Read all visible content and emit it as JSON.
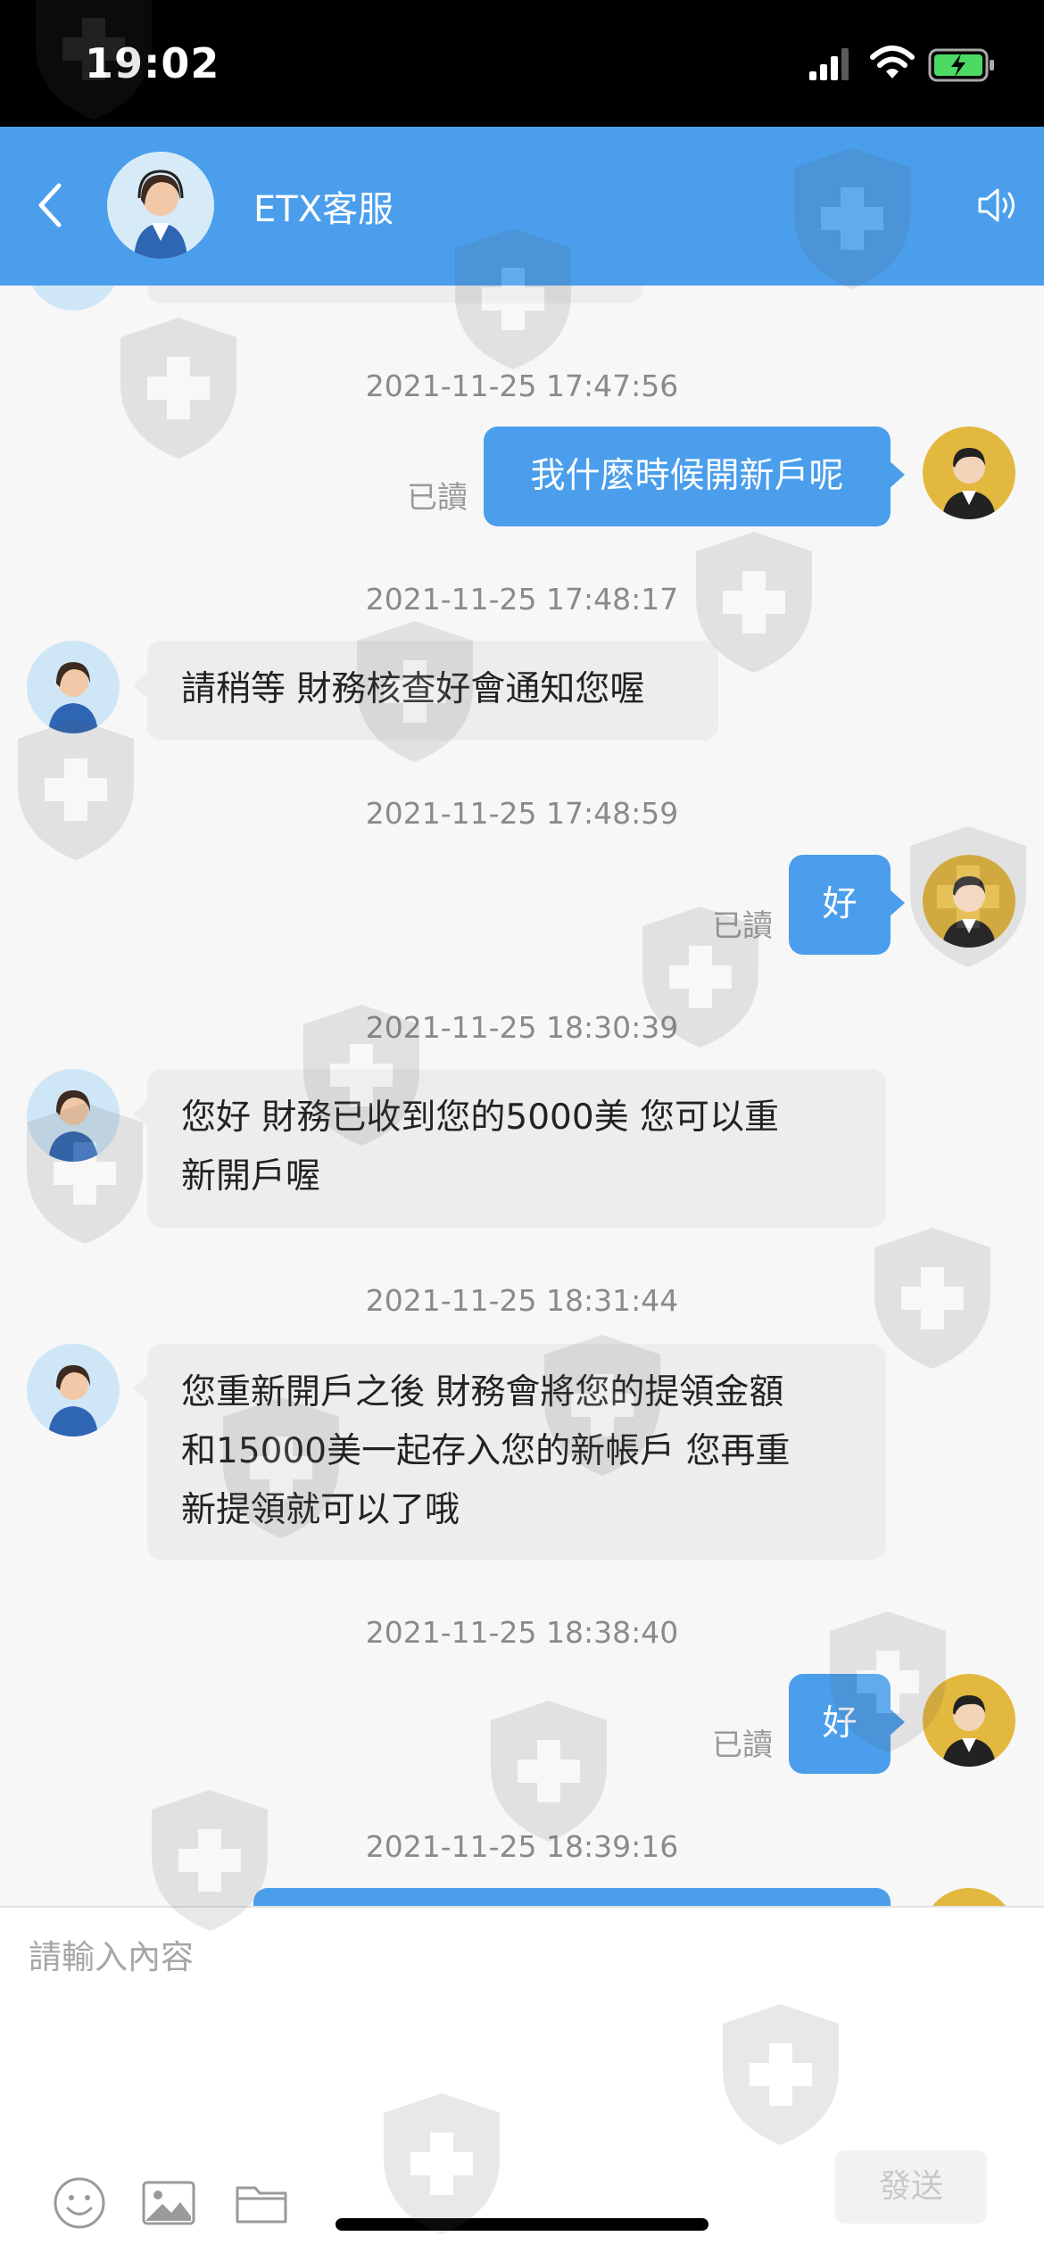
{
  "status_bar": {
    "time": "19:02"
  },
  "header": {
    "title": "ETX客服"
  },
  "messages": [
    {
      "timestamp": "2021-11-25 17:47:56",
      "sender": "user",
      "text": "我什麼時候開新戶呢",
      "read": "已讀"
    },
    {
      "timestamp": "2021-11-25 17:48:17",
      "sender": "agent",
      "text": "請稍等 財務核查好會通知您喔"
    },
    {
      "timestamp": "2021-11-25 17:48:59",
      "sender": "user",
      "text": "好",
      "read": "已讀"
    },
    {
      "timestamp": "2021-11-25 18:30:39",
      "sender": "agent",
      "lines": [
        "您好 財務已收到您的5000美 您可以重",
        "新開戶喔"
      ]
    },
    {
      "timestamp": "2021-11-25 18:31:44",
      "sender": "agent",
      "lines": [
        "您重新開戶之後 財務會將您的提領金額",
        "和15000美一起存入您的新帳戶 您再重",
        "新提領就可以了哦"
      ]
    },
    {
      "timestamp": "2021-11-25 18:38:40",
      "sender": "user",
      "text": "好",
      "read": "已讀"
    },
    {
      "timestamp": "2021-11-25 18:39:16"
    }
  ],
  "composer": {
    "placeholder": "請輸入內容",
    "send_label": "發送"
  },
  "icons": [
    "back-icon",
    "speaker-icon",
    "emoji-icon",
    "image-icon",
    "folder-icon"
  ],
  "colors": {
    "header": "#4a9eec",
    "outgoing_bubble": "#4a9eec",
    "incoming_bubble": "#eceeee",
    "user_avatar": "#e3b83e"
  }
}
